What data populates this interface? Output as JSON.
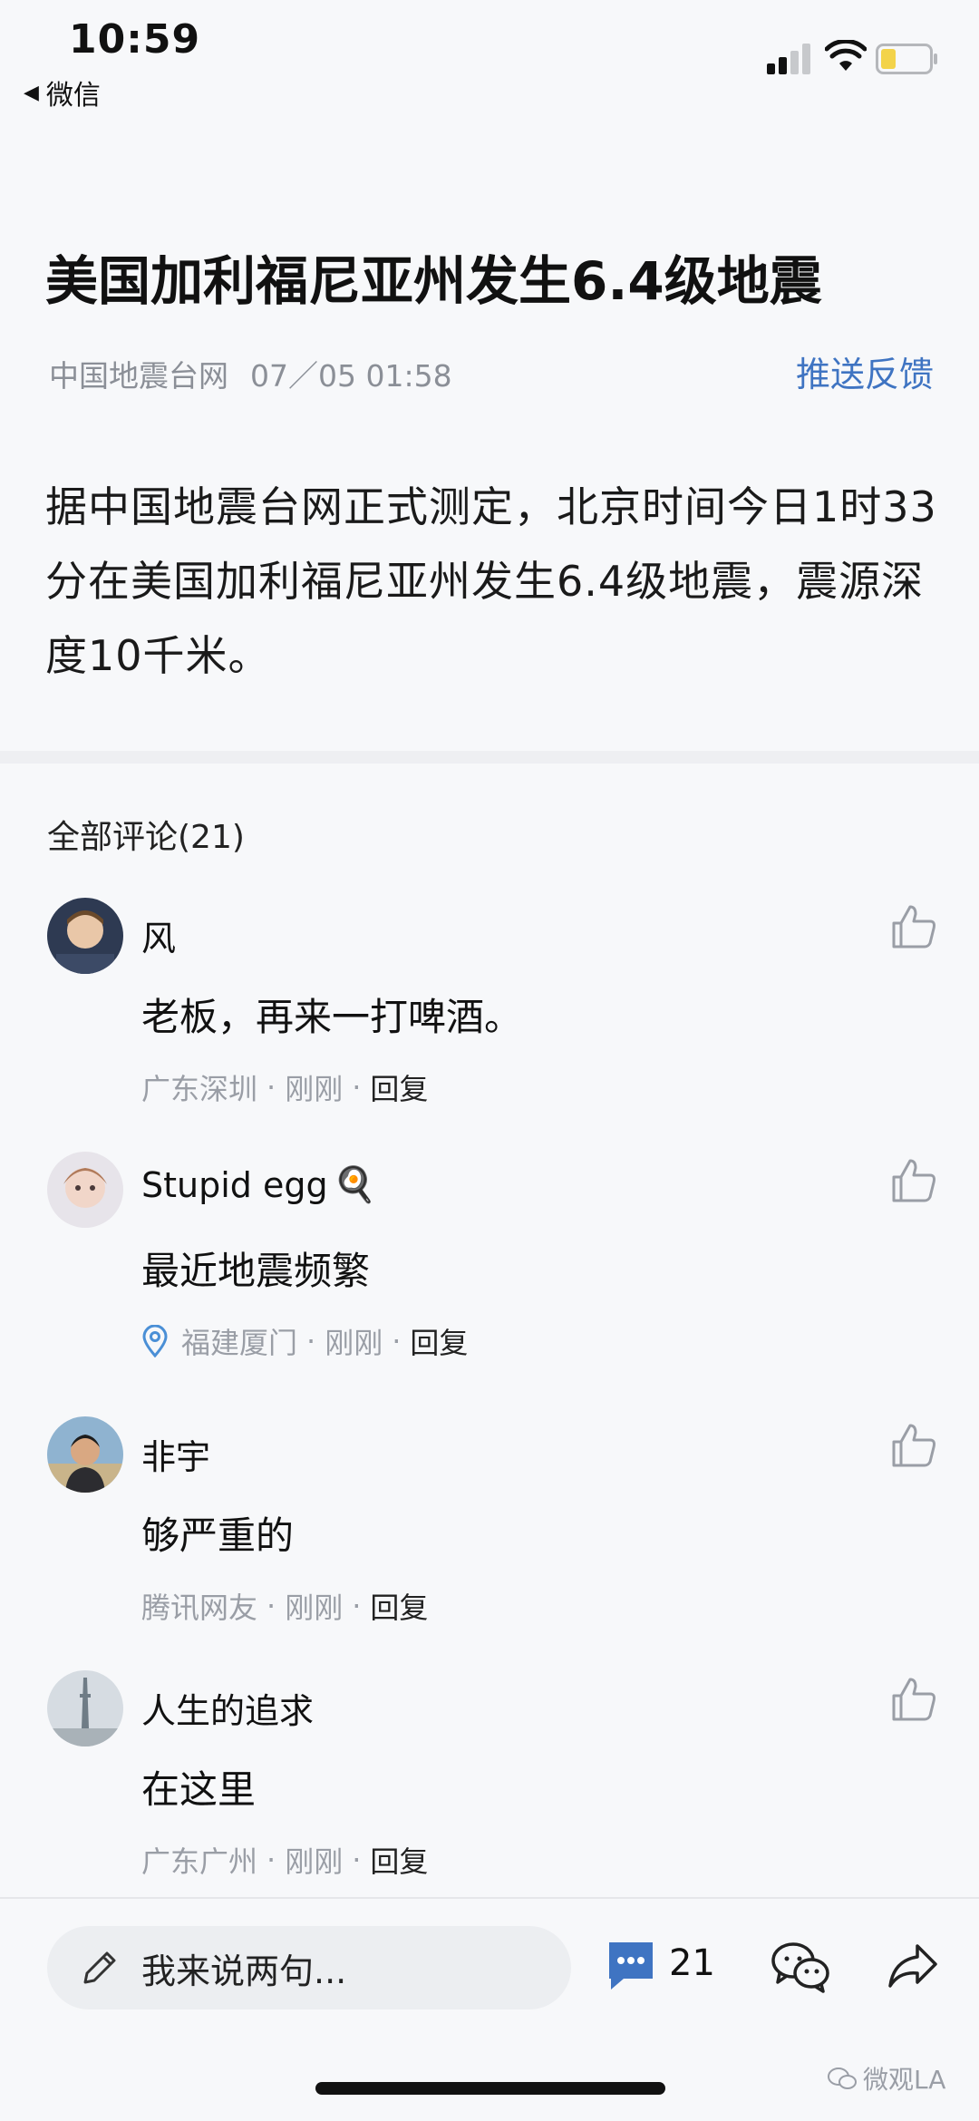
{
  "status_bar": {
    "time": "10:59",
    "back_app": "微信",
    "back_arrow": "◀"
  },
  "article": {
    "title": "美国加利福尼亚州发生6.4级地震",
    "source": "中国地震台网",
    "timestamp": "07／05 01:58",
    "feedback_label": "推送反馈",
    "body": "据中国地震台网正式测定，北京时间今日1时33分在美国加利福尼亚州发生6.4级地震，震源深度10千米。"
  },
  "comments": {
    "header": "全部评论(21)",
    "items": [
      {
        "name": "风",
        "text": "老板，再来一打啤酒。",
        "location": "广东深圳",
        "time": "刚刚",
        "reply": "回复",
        "icon": "like-icon"
      },
      {
        "name": "Stupid egg",
        "emoji": "🍳",
        "text": "最近地震频繁",
        "location": "福建厦门",
        "time": "刚刚",
        "reply": "回复",
        "location_icon": "location-pin-icon"
      },
      {
        "name": "非宇",
        "text": "够严重的",
        "location": "腾讯网友",
        "time": "刚刚",
        "reply": "回复"
      },
      {
        "name": "人生的追求",
        "text": "在这里",
        "location": "广东广州",
        "time": "刚刚",
        "reply": "回复"
      }
    ]
  },
  "bottom_bar": {
    "input_placeholder": "我来说两句...",
    "comment_count": "21",
    "watermark": "微观LA"
  },
  "colors": {
    "accent": "#3f74c2",
    "muted": "#8b8f97",
    "background": "#f7f8fa"
  }
}
